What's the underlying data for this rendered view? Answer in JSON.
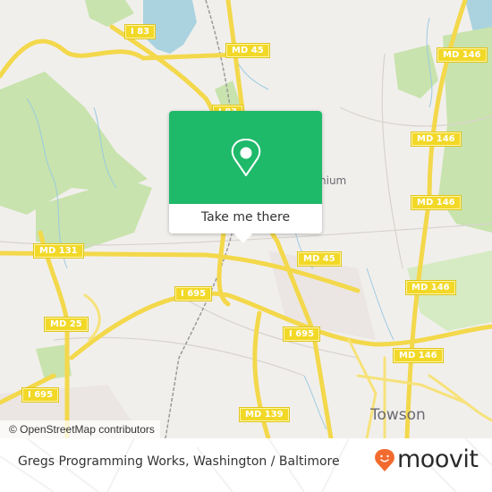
{
  "map": {
    "road_shields": [
      {
        "id": "i83-north",
        "label": "I 83"
      },
      {
        "id": "md45-north",
        "label": "MD 45"
      },
      {
        "id": "i83-center",
        "label": "I 83"
      },
      {
        "id": "md146-ne",
        "label": "MD 146"
      },
      {
        "id": "md146-east-1",
        "label": "MD 146"
      },
      {
        "id": "md146-east-2",
        "label": "MD 146"
      },
      {
        "id": "md131",
        "label": "MD 131"
      },
      {
        "id": "md45-center",
        "label": "MD 45"
      },
      {
        "id": "md146-east-3",
        "label": "MD 146"
      },
      {
        "id": "i695-center",
        "label": "I 695"
      },
      {
        "id": "md25",
        "label": "MD 25"
      },
      {
        "id": "i695-east",
        "label": "I 695"
      },
      {
        "id": "md146-south",
        "label": "MD 146"
      },
      {
        "id": "i695-west",
        "label": "I 695"
      },
      {
        "id": "md139",
        "label": "MD 139"
      }
    ],
    "place_labels": {
      "towson": "Towson",
      "timonium_partial": "nium"
    },
    "attribution": "© OpenStreetMap contributors",
    "colors": {
      "land": "#f1efec",
      "water": "#aad3df",
      "park": "#c8e3ad",
      "road": "#f6e27a",
      "shield": "#f2d827"
    }
  },
  "popup": {
    "icon": "location-pin-icon",
    "action_label": "Take me there",
    "accent_color": "#1fb96a"
  },
  "footer": {
    "title": "Gregs Programming Works, Washington / Baltimore",
    "brand": "moovit",
    "brand_color": "#f26a2e"
  }
}
